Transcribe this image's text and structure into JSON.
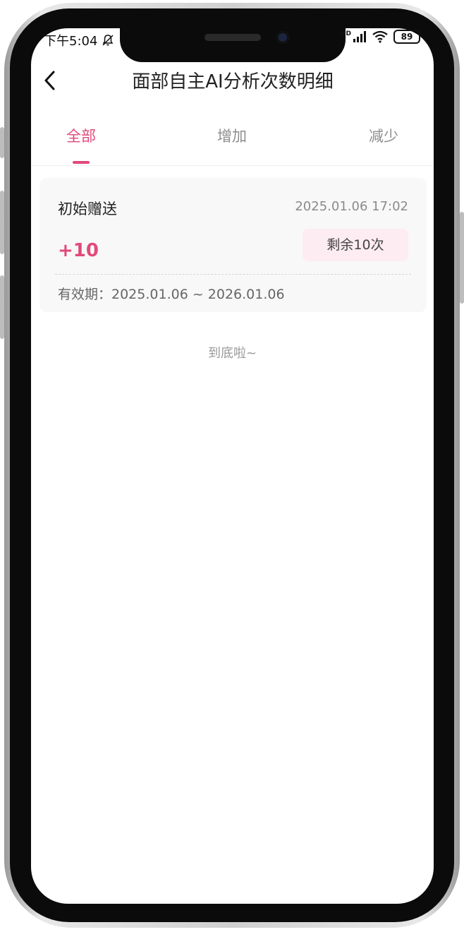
{
  "status_bar": {
    "time": "下午5:04",
    "network": "HD",
    "battery": "89"
  },
  "header": {
    "title": "面部自主AI分析次数明细"
  },
  "tabs": [
    {
      "label": "全部",
      "active": true
    },
    {
      "label": "增加",
      "active": false
    },
    {
      "label": "减少",
      "active": false
    }
  ],
  "records": [
    {
      "title": "初始赠送",
      "time": "2025.01.06 17:02",
      "amount": "+10",
      "remaining": "剩余10次",
      "validity": "有效期：2025.01.06 ~ 2026.01.06"
    }
  ],
  "end_note": "到底啦~",
  "colors": {
    "accent": "#e04a7a",
    "badge_bg": "#fdecf1",
    "card_bg": "#f8f8f8"
  }
}
